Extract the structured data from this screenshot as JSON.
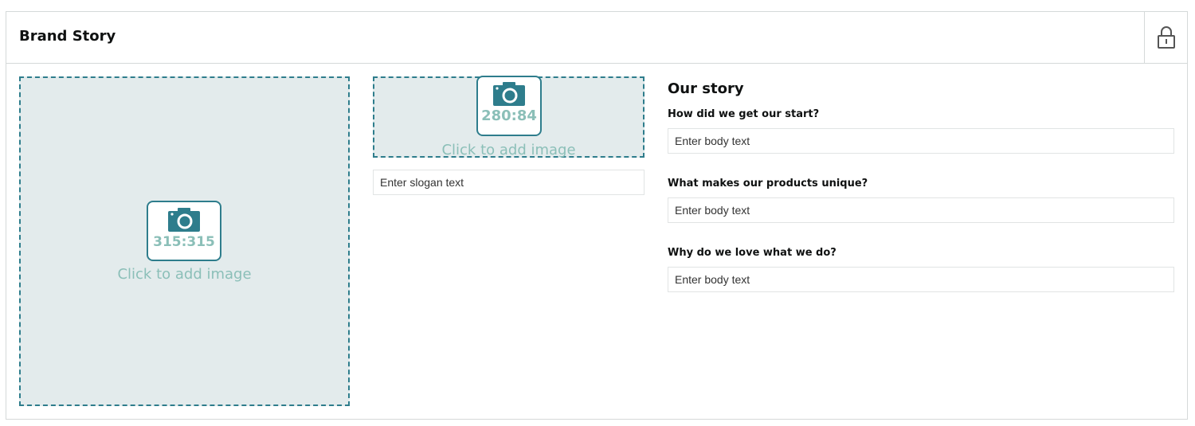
{
  "header": {
    "title": "Brand Story",
    "lock_icon": "lock-icon"
  },
  "large_image": {
    "ratio": "315:315",
    "label": "Click to add image",
    "icon": "camera-icon"
  },
  "small_image": {
    "ratio": "280:84",
    "label": "Click to add image",
    "icon": "camera-icon"
  },
  "slogan": {
    "placeholder": "Enter slogan text",
    "value": ""
  },
  "story": {
    "title": "Our story",
    "questions": [
      {
        "label": "How did we get our start?",
        "placeholder": "Enter body text"
      },
      {
        "label": "What makes our products unique?",
        "placeholder": "Enter body text"
      },
      {
        "label": "Why do we love what we do?",
        "placeholder": "Enter body text"
      }
    ]
  },
  "colors": {
    "accent": "#2e7d8c",
    "dropzone_bg": "#e3ebec",
    "muted_teal": "#8bbfb8",
    "border": "#d5d9d9"
  }
}
